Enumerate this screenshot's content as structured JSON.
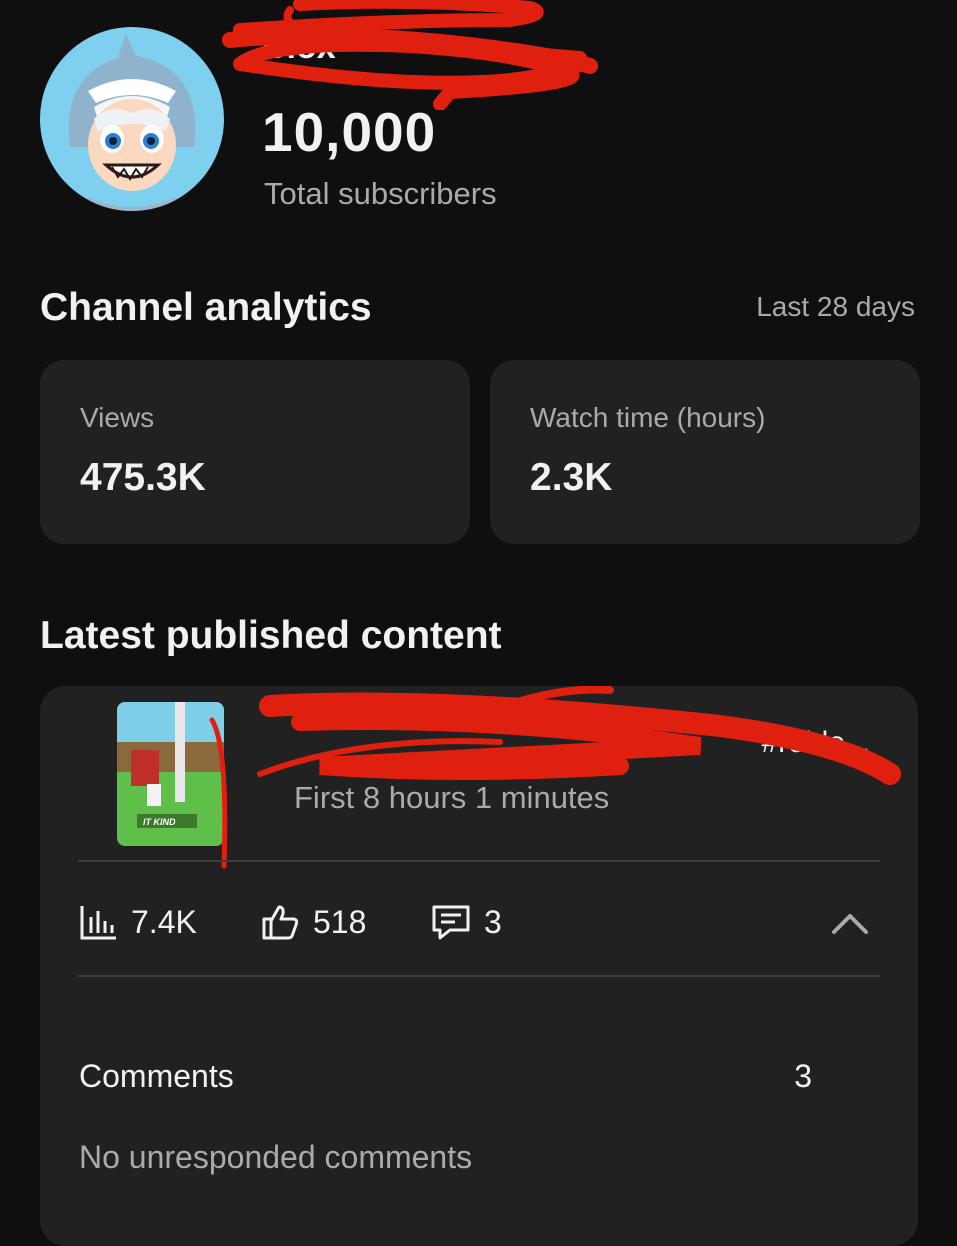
{
  "header": {
    "channel_name": "Blox",
    "subscriber_count": "10,000",
    "subscriber_label": "Total subscribers"
  },
  "analytics": {
    "title": "Channel analytics",
    "range": "Last 28 days",
    "cards": [
      {
        "label": "Views",
        "value": "475.3K"
      },
      {
        "label": "Watch time (hours)",
        "value": "2.3K"
      }
    ]
  },
  "latest": {
    "title": "Latest published content",
    "video_title": "#roblo...",
    "video_subtitle": "First 8 hours 1 minutes",
    "thumbnail_caption": "IT KIND",
    "stats": {
      "views": "7.4K",
      "likes": "518",
      "comments": "3"
    },
    "comments_label": "Comments",
    "comments_value": "3",
    "unresponded": "No unresponded comments"
  },
  "icons": {
    "views": "bar-chart-icon",
    "likes": "thumbs-up-icon",
    "comments": "comment-icon",
    "collapse": "chevron-up-icon"
  },
  "colors": {
    "background": "#0f0f0f",
    "card": "#212121",
    "secondary_text": "#aaaaaa",
    "redaction": "#e0200f"
  }
}
